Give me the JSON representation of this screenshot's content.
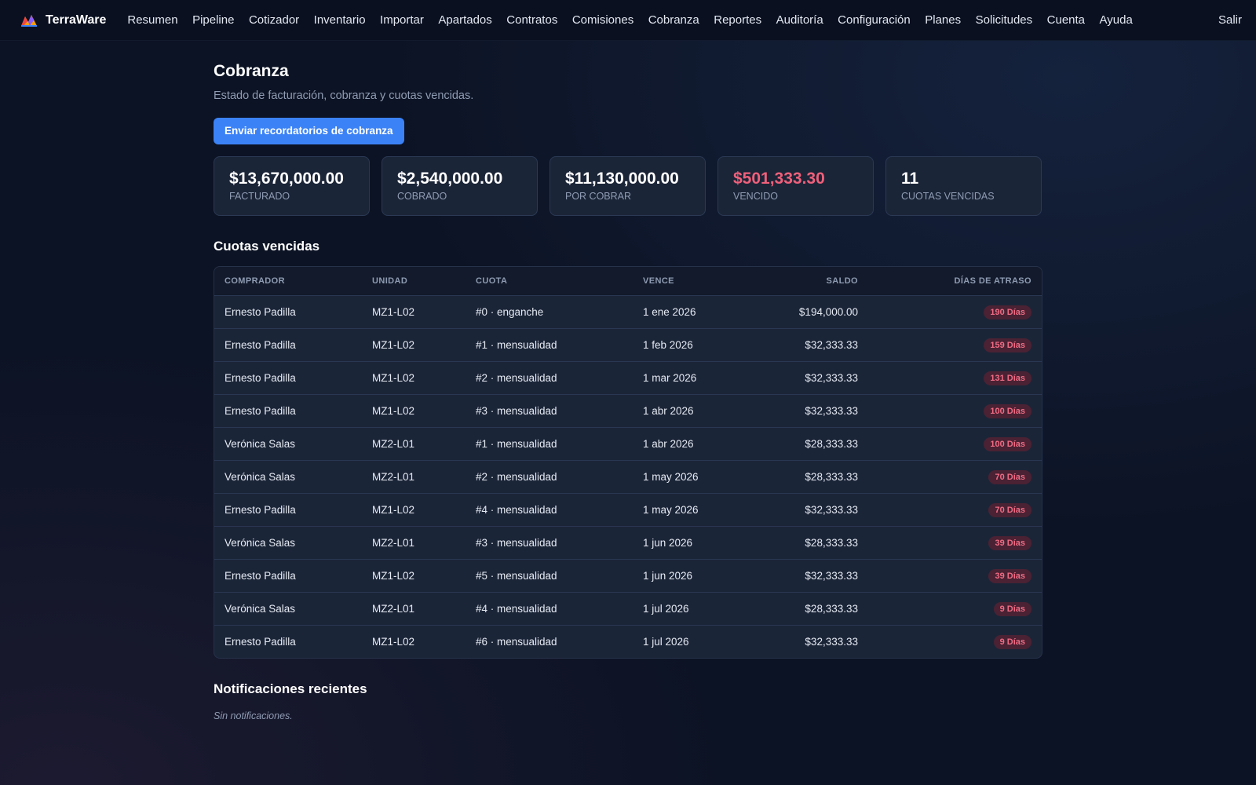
{
  "brand": {
    "name": "TerraWare"
  },
  "nav": {
    "items": [
      "Resumen",
      "Pipeline",
      "Cotizador",
      "Inventario",
      "Importar",
      "Apartados",
      "Contratos",
      "Comisiones",
      "Cobranza",
      "Reportes",
      "Auditoría",
      "Configuración",
      "Planes",
      "Solicitudes",
      "Cuenta",
      "Ayuda"
    ],
    "logout": "Salir"
  },
  "page": {
    "title": "Cobranza",
    "subtitle": "Estado de facturación, cobranza y cuotas vencidas.",
    "send_reminders_label": "Enviar recordatorios de cobranza"
  },
  "stats": [
    {
      "value": "$13,670,000.00",
      "label": "FACTURADO"
    },
    {
      "value": "$2,540,000.00",
      "label": "COBRADO"
    },
    {
      "value": "$11,130,000.00",
      "label": "POR COBRAR"
    },
    {
      "value": "$501,333.30",
      "label": "VENCIDO",
      "color": "#f0607a"
    },
    {
      "value": "11",
      "label": "CUOTAS VENCIDAS"
    }
  ],
  "overdue": {
    "title": "Cuotas vencidas",
    "headers": [
      "COMPRADOR",
      "UNIDAD",
      "CUOTA",
      "VENCE",
      "SALDO",
      "DÍAS DE ATRASO"
    ],
    "rows": [
      [
        "Ernesto Padilla",
        "MZ1-L02",
        "#0 · enganche",
        "1 ene 2026",
        "$194,000.00",
        "190 Días"
      ],
      [
        "Ernesto Padilla",
        "MZ1-L02",
        "#1 · mensualidad",
        "1 feb 2026",
        "$32,333.33",
        "159 Días"
      ],
      [
        "Ernesto Padilla",
        "MZ1-L02",
        "#2 · mensualidad",
        "1 mar 2026",
        "$32,333.33",
        "131 Días"
      ],
      [
        "Ernesto Padilla",
        "MZ1-L02",
        "#3 · mensualidad",
        "1 abr 2026",
        "$32,333.33",
        "100 Días"
      ],
      [
        "Verónica Salas",
        "MZ2-L01",
        "#1 · mensualidad",
        "1 abr 2026",
        "$28,333.33",
        "100 Días"
      ],
      [
        "Verónica Salas",
        "MZ2-L01",
        "#2 · mensualidad",
        "1 may 2026",
        "$28,333.33",
        "70 Días"
      ],
      [
        "Ernesto Padilla",
        "MZ1-L02",
        "#4 · mensualidad",
        "1 may 2026",
        "$32,333.33",
        "70 Días"
      ],
      [
        "Verónica Salas",
        "MZ2-L01",
        "#3 · mensualidad",
        "1 jun 2026",
        "$28,333.33",
        "39 Días"
      ],
      [
        "Ernesto Padilla",
        "MZ1-L02",
        "#5 · mensualidad",
        "1 jun 2026",
        "$32,333.33",
        "39 Días"
      ],
      [
        "Verónica Salas",
        "MZ2-L01",
        "#4 · mensualidad",
        "1 jul 2026",
        "$28,333.33",
        "9 Días"
      ],
      [
        "Ernesto Padilla",
        "MZ1-L02",
        "#6 · mensualidad",
        "1 jul 2026",
        "$32,333.33",
        "9 Días"
      ]
    ]
  },
  "notifications": {
    "title": "Notificaciones recientes",
    "empty": "Sin notificaciones."
  }
}
